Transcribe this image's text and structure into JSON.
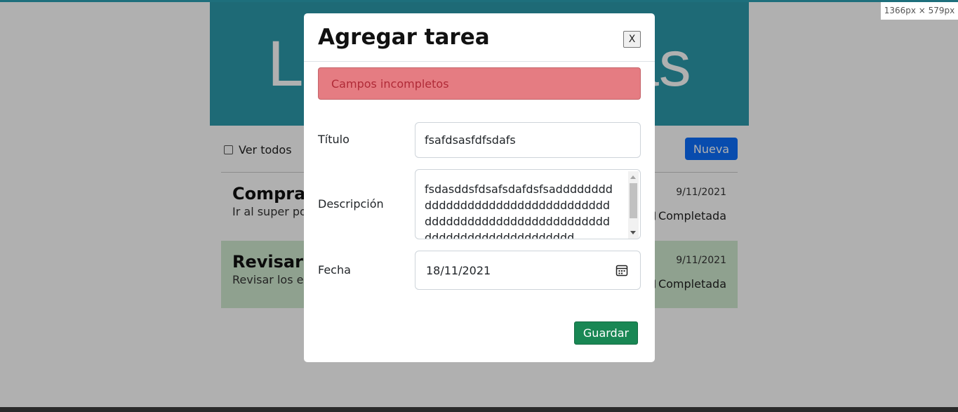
{
  "viewport_label": "1366px × 579px",
  "app": {
    "hero_title": "Lista de tareas",
    "filter_label": "Ver todos",
    "new_button": "Nueva",
    "tasks": [
      {
        "title": "Compras",
        "description": "Ir al super por",
        "date": "9/11/2021",
        "completed_label": "Completada",
        "status_color": "#ffffff"
      },
      {
        "title": "Revisar",
        "description": "Revisar los e",
        "date": "9/11/2021",
        "completed_label": "Completada",
        "status_color": "#cfe9cf"
      }
    ]
  },
  "modal": {
    "title": "Agregar tarea",
    "close_label": "X",
    "alert": "Campos incompletos",
    "fields": {
      "title": {
        "label": "Título",
        "value": "fsafdsasfdfsdafs"
      },
      "description": {
        "label": "Descripción",
        "value": "fsdasddsfdsafsdafdsfsaddddddddddddddddddddddddddddddddddddddddddddddddddddddddddddddddddddddddddddddddd"
      },
      "date": {
        "label": "Fecha",
        "value": "18/11/2021",
        "icon": "calendar-icon"
      }
    },
    "save_button": "Guardar"
  },
  "colors": {
    "hero": "#2c9aab",
    "primary": "#0d6efd",
    "success": "#198754",
    "danger_text": "#b02a37"
  }
}
